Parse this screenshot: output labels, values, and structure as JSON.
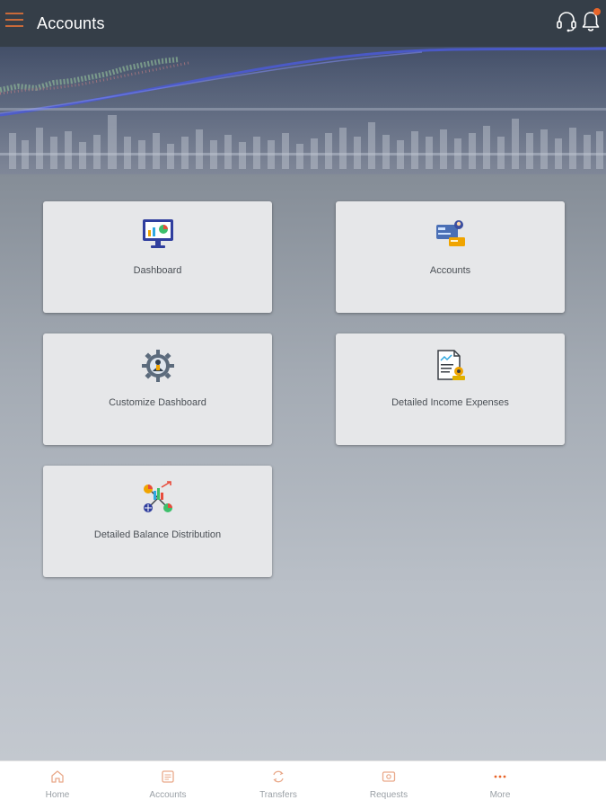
{
  "header": {
    "title": "Accounts",
    "menu_icon": "hamburger-menu-icon",
    "support_icon": "headset-icon",
    "notification_icon": "bell-icon",
    "accent_color": "#e8652a"
  },
  "tiles": [
    {
      "label": "Dashboard",
      "icon": "monitor-chart-icon"
    },
    {
      "label": "Accounts",
      "icon": "account-card-icon"
    },
    {
      "label": "Customize Dashboard",
      "icon": "gear-icon"
    },
    {
      "label": "Detailed Income Expenses",
      "icon": "document-coins-icon"
    },
    {
      "label": "Detailed Balance Distribution",
      "icon": "network-chart-icon"
    }
  ],
  "bottom_nav": [
    {
      "label": "Home",
      "icon": "home-icon"
    },
    {
      "label": "Accounts",
      "icon": "accounts-icon"
    },
    {
      "label": "Transfers",
      "icon": "transfer-icon"
    },
    {
      "label": "Requests",
      "icon": "requests-icon"
    },
    {
      "label": "More",
      "icon": "more-dots-icon"
    }
  ]
}
